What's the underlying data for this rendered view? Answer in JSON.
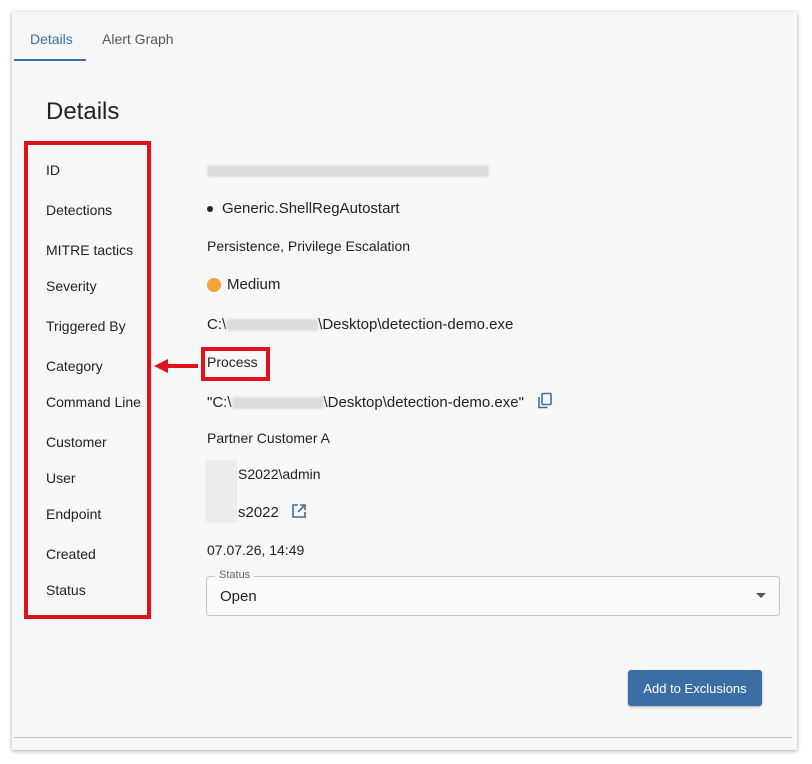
{
  "tabs": [
    {
      "label": "Details",
      "active": true
    },
    {
      "label": "Alert Graph",
      "active": false
    }
  ],
  "title": "Details",
  "fields": {
    "id": {
      "label": "ID"
    },
    "detections": {
      "label": "Detections",
      "items": [
        "Generic.ShellRegAutostart"
      ]
    },
    "mitre": {
      "label": "MITRE tactics",
      "value": "Persistence, Privilege Escalation"
    },
    "severity": {
      "label": "Severity",
      "value": "Medium",
      "color": "#f5a33b"
    },
    "triggered_by": {
      "label": "Triggered By",
      "prefix": "C:\\",
      "suffix": "\\Desktop\\detection-demo.exe"
    },
    "category": {
      "label": "Category",
      "value": "Process"
    },
    "command_line": {
      "label": "Command Line",
      "prefix": "\"C:\\",
      "suffix": "\\Desktop\\detection-demo.exe\""
    },
    "customer": {
      "label": "Customer",
      "value": "Partner Customer A"
    },
    "user": {
      "label": "User",
      "value": "S2022\\admin"
    },
    "endpoint": {
      "label": "Endpoint",
      "value": "s2022"
    },
    "created": {
      "label": "Created",
      "value": "07.07.26, 14:49"
    },
    "status": {
      "label": "Status",
      "legend": "Status",
      "value": "Open"
    }
  },
  "actions": {
    "add_exclusions": "Add to Exclusions"
  },
  "colors": {
    "accent": "#3a6fa0",
    "highlight": "#e0111b",
    "severity_medium": "#f5a33b"
  },
  "icons": {
    "copy": "copy-icon",
    "open": "open-external-icon",
    "dropdown": "chevron-down-icon"
  }
}
